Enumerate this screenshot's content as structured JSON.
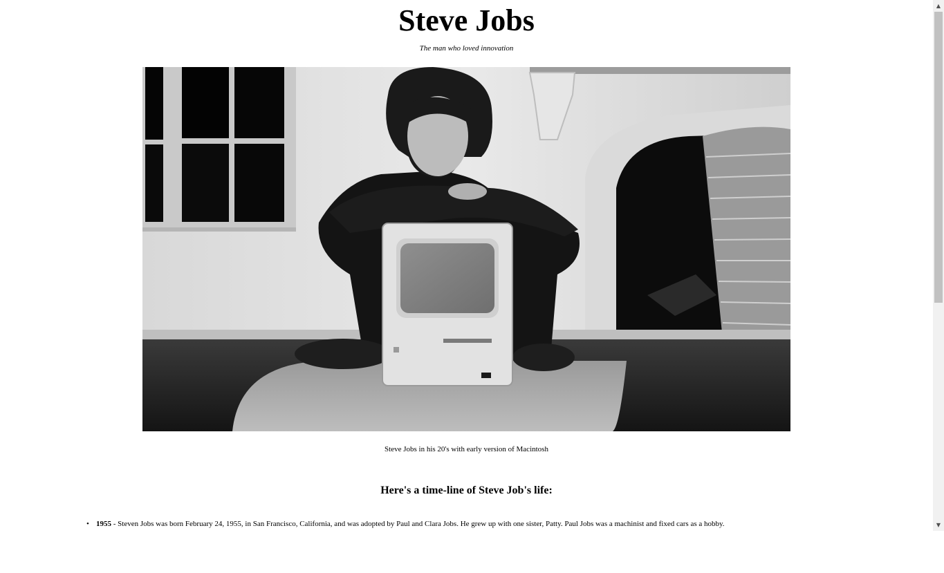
{
  "header": {
    "title": "Steve Jobs",
    "subtitle": "The man who loved innovation"
  },
  "figure": {
    "image_name": "steve-jobs-with-macintosh-photo",
    "caption": "Steve Jobs in his 20's with early version of Macintosh"
  },
  "timeline": {
    "heading": "Here's a time-line of Steve Job's life:",
    "items": [
      {
        "bullet": "•",
        "year": "1955",
        "text": " - Steven Jobs was born February 24, 1955, in San Francisco, California, and was adopted by Paul and Clara Jobs. He grew up with one sister, Patty. Paul Jobs was a machinist and fixed cars as a hobby."
      }
    ]
  },
  "scrollbar": {
    "up_icon": "▲",
    "down_icon": "▼"
  }
}
